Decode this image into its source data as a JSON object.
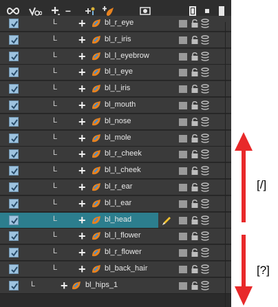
{
  "toolbar": {
    "icons": [
      "infinity-icon",
      "onion-skin-icon",
      "add-remove-layer-icon",
      "add-peg-icon",
      "add-drawing-icon",
      "animation-icon",
      "camera-icon",
      "small-square-icon",
      "tall-square-icon"
    ],
    "minus_label": "−"
  },
  "colors": {
    "panel_bg": "#2b2b2b",
    "row_bg": "#3a3a3a",
    "selected_row_bg": "#2c7e8e",
    "arrow_red": "#e8292a"
  },
  "layers": [
    {
      "name": "bl_r_eye",
      "indent_glyph": "L",
      "selected": false
    },
    {
      "name": "bl_r_iris",
      "indent_glyph": "L",
      "selected": false
    },
    {
      "name": "bl_l_eyebrow",
      "indent_glyph": "L",
      "selected": false
    },
    {
      "name": "bl_l_eye",
      "indent_glyph": "L",
      "selected": false
    },
    {
      "name": "bl_l_iris",
      "indent_glyph": "L",
      "selected": false
    },
    {
      "name": "bl_mouth",
      "indent_glyph": "L",
      "selected": false
    },
    {
      "name": "bl_nose",
      "indent_glyph": "L",
      "selected": false
    },
    {
      "name": "bl_mole",
      "indent_glyph": "L",
      "selected": false
    },
    {
      "name": "bl_r_cheek",
      "indent_glyph": "L",
      "selected": false
    },
    {
      "name": "bl_l_cheek",
      "indent_glyph": "L",
      "selected": false
    },
    {
      "name": "bl_r_ear",
      "indent_glyph": "L",
      "selected": false
    },
    {
      "name": "bl_l_ear",
      "indent_glyph": "L",
      "selected": false
    },
    {
      "name": "bl_head",
      "indent_glyph": "L",
      "selected": true
    },
    {
      "name": "bl_l_flower",
      "indent_glyph": "L",
      "selected": false
    },
    {
      "name": "bl_r_flower",
      "indent_glyph": "L",
      "selected": false
    },
    {
      "name": "bl_back_hair",
      "indent_glyph": "L",
      "selected": false
    },
    {
      "name": "bl_hips_1",
      "indent_glyph": "L",
      "selected": false
    }
  ],
  "annotations": {
    "up_shortcut": "[/]",
    "down_shortcut": "[?]"
  }
}
